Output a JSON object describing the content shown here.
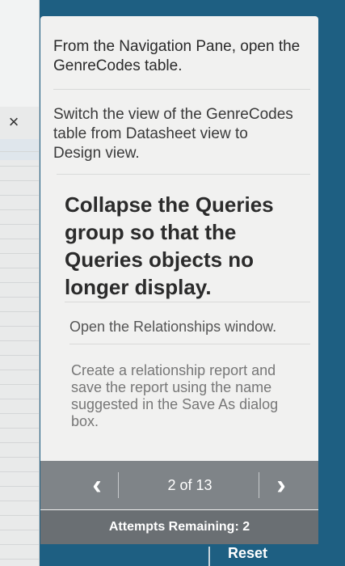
{
  "close": {
    "icon": "close-icon",
    "glyph": "×"
  },
  "tasks": [
    {
      "label": "From the Navigation Pane, open the GenreCodes table."
    },
    {
      "label": "Switch the view of the GenreCodes table from Datasheet view to Design view."
    },
    {
      "label": "Collapse the Queries group so that the Queries objects no longer display."
    },
    {
      "label": "Open the Relationships window."
    },
    {
      "label": "Create a relationship report and save the report using the name suggested in the Save As dialog box."
    }
  ],
  "nav": {
    "prev_icon": "chevron-left-icon",
    "prev_glyph": "‹",
    "counter": "2 of 13",
    "next_icon": "chevron-right-icon",
    "next_glyph": "›"
  },
  "attempts": "Attempts Remaining: 2",
  "bottom": {
    "partial_label": "Reset"
  },
  "colors": {
    "panel": "#f1f1f0",
    "frame": "#1e5f82",
    "nav": "#7f8488",
    "attempts": "#6a6f73"
  }
}
